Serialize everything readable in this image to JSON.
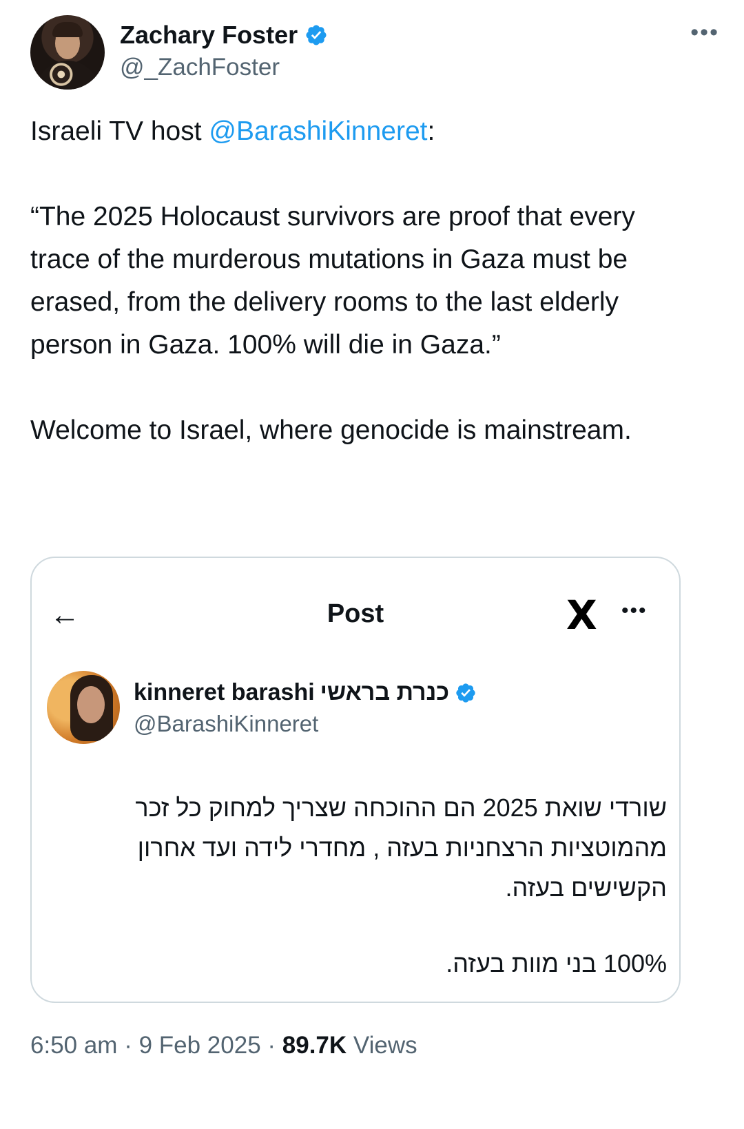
{
  "author": {
    "name": "Zachary Foster",
    "handle": "@_ZachFoster",
    "verified_icon": "verified-badge-icon",
    "more_label": "•••"
  },
  "tweet": {
    "line1_prefix": "Israeli TV host ",
    "line1_mention": "@BarashiKinneret",
    "line1_suffix": ":",
    "quote": "“The 2025 Holocaust survivors are proof that every trace of the murderous mutations in Gaza must be erased, from the delivery rooms to the last elderly person in Gaza.  100% will die in Gaza.”",
    "closing": "Welcome to Israel, where genocide is mainstream."
  },
  "embedded": {
    "back_icon": "←",
    "title": "Post",
    "logo_text": "X",
    "more_label": "•••",
    "author_name": "kinneret barashi",
    "author_name_he": "כנרת בראשי",
    "author_handle": "@BarashiKinneret",
    "body_p1": "שורדי שואת 2025 הם ההוכחה שצריך למחוק כל זכר מהמוטציות הרצחניות בעזה , מחדרי לידה ועד אחרון הקשישים בעזה.",
    "body_p2": "100% בני מוות בעזה."
  },
  "meta": {
    "time": "6:50 am",
    "sep1": " · ",
    "date": "9 Feb 2025",
    "sep2": " · ",
    "views_count": "89.7K",
    "views_label": " Views"
  },
  "colors": {
    "mention": "#1d9bf0",
    "verified": "#1d9bf0",
    "secondary_text": "#536471",
    "border": "#cfd9de"
  }
}
